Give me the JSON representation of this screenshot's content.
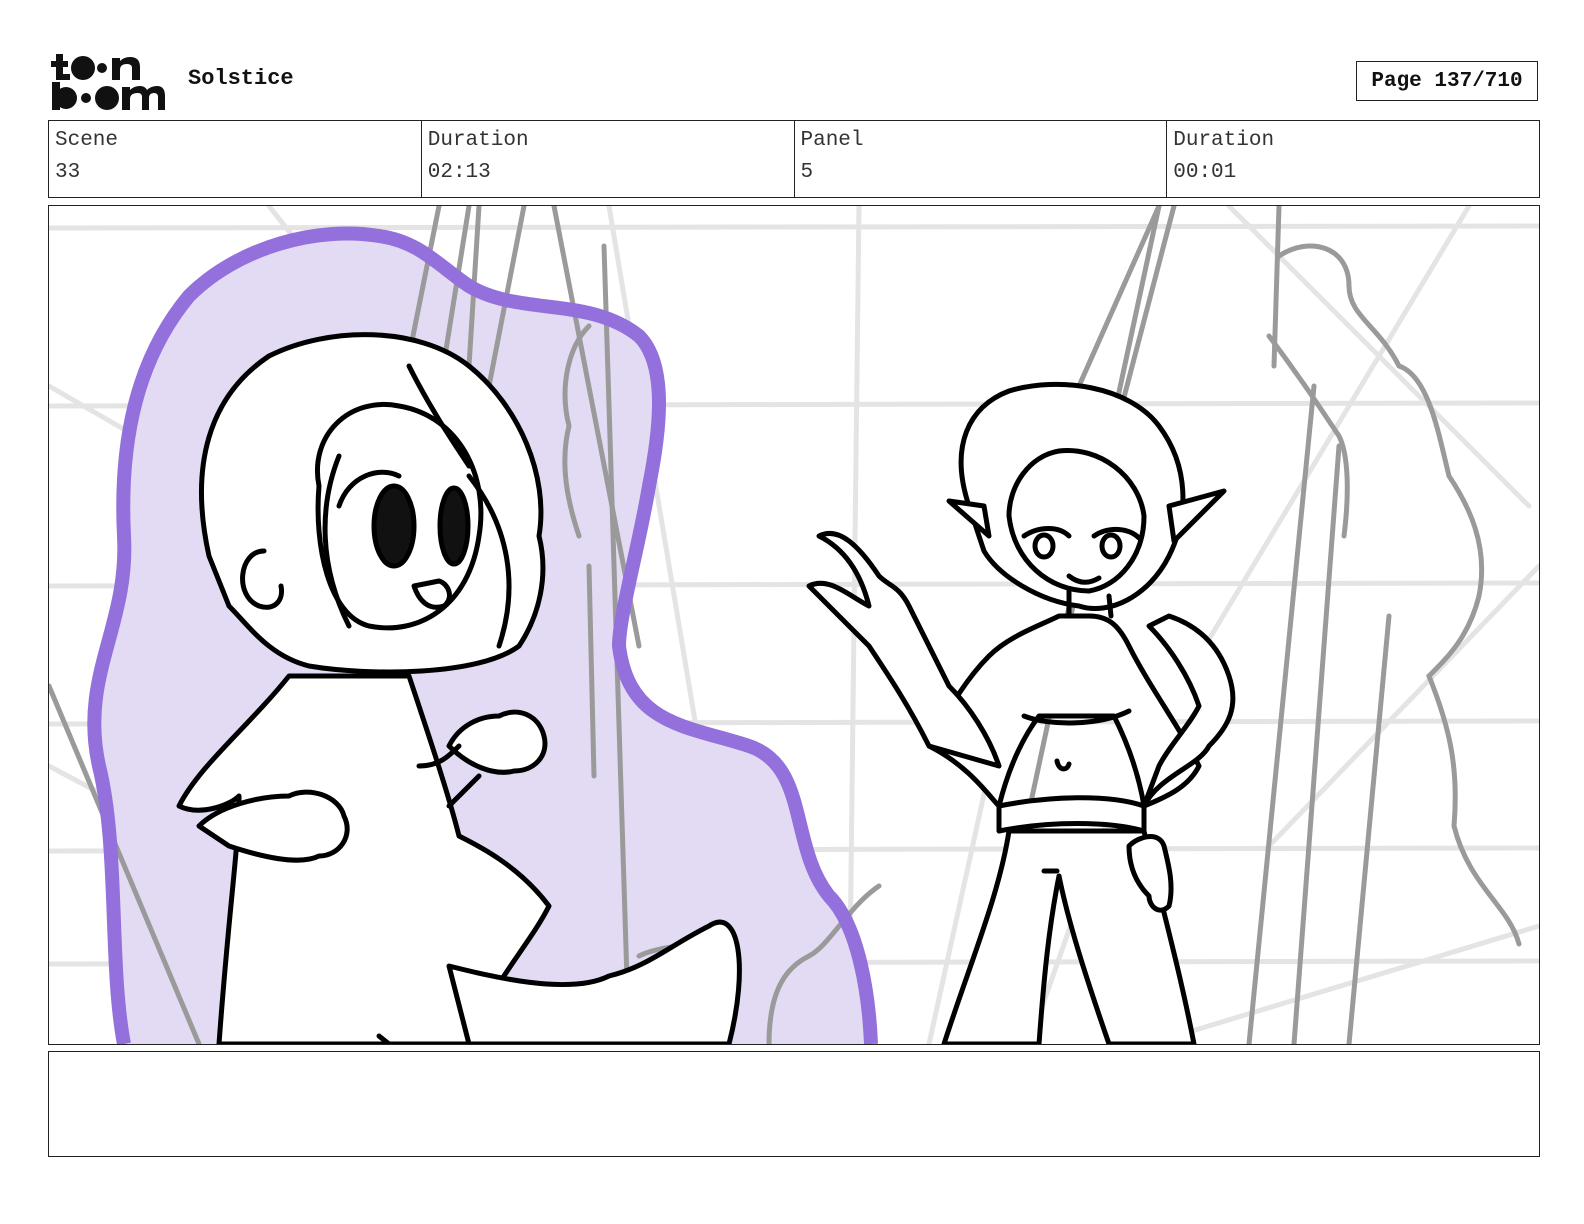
{
  "header": {
    "logo_text": "toon boom",
    "project_title": "Solstice",
    "page_label": "Page 137/710"
  },
  "info": {
    "scene_label": "Scene",
    "scene_value": "33",
    "scene_duration_label": "Duration",
    "scene_duration_value": "02:13",
    "panel_label": "Panel",
    "panel_value": "5",
    "panel_duration_label": "Duration",
    "panel_duration_value": "00:01"
  },
  "colors": {
    "aura_stroke": "#9370db",
    "aura_fill": "#e3dbf4",
    "grid_light": "#e4e4e4",
    "lines_gray": "#9a9a9a",
    "ink": "#000000"
  },
  "notes": {
    "text": ""
  }
}
